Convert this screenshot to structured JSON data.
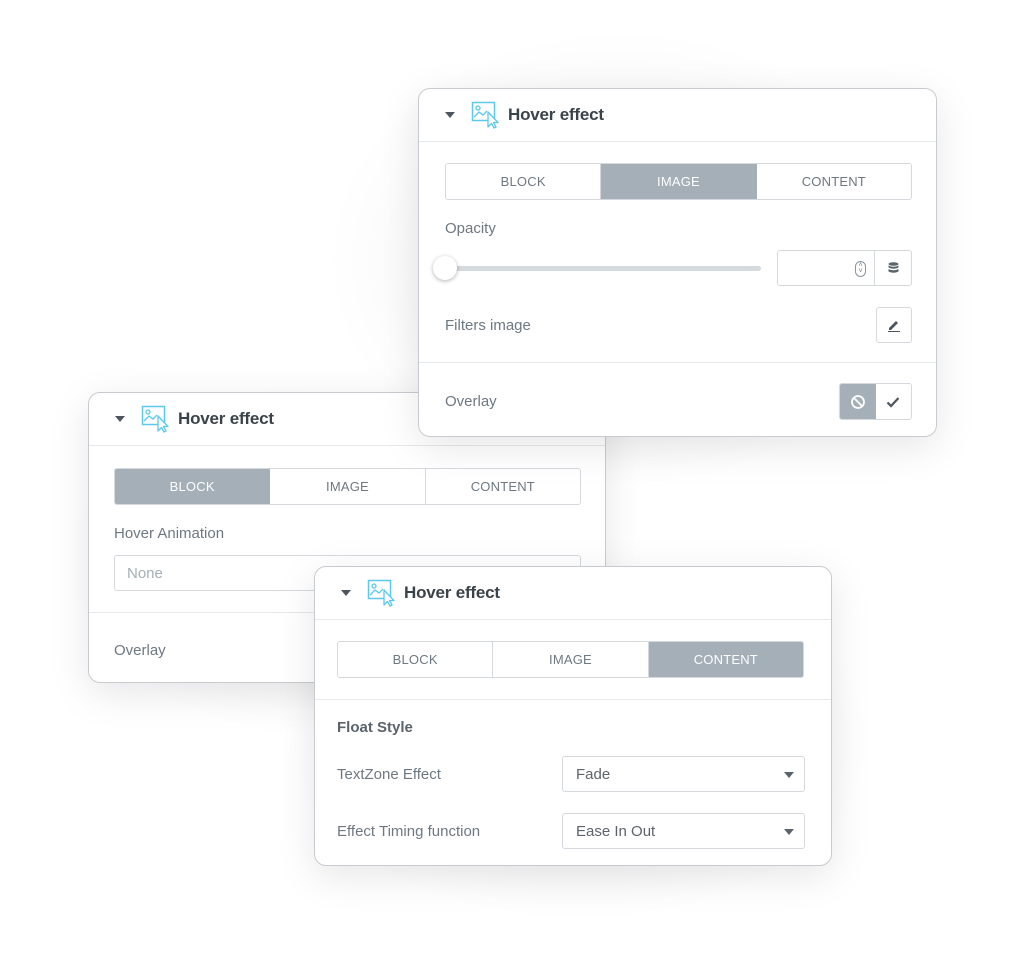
{
  "panels": {
    "top": {
      "title": "Hover effect",
      "icon": "image-hover-icon",
      "tabs": [
        {
          "label": "BLOCK",
          "active": false
        },
        {
          "label": "IMAGE",
          "active": true
        },
        {
          "label": "CONTENT",
          "active": false
        }
      ],
      "opacity_label": "Opacity",
      "opacity_value": "",
      "opacity_slider_fraction": 0,
      "filters_label": "Filters image",
      "overlay_label": "Overlay",
      "overlay_state": "off"
    },
    "left": {
      "title": "Hover effect",
      "icon": "image-hover-icon",
      "tabs": [
        {
          "label": "BLOCK",
          "active": true
        },
        {
          "label": "IMAGE",
          "active": false
        },
        {
          "label": "CONTENT",
          "active": false
        }
      ],
      "hover_animation_label": "Hover Animation",
      "hover_animation_placeholder": "None",
      "overlay_label": "Overlay"
    },
    "bottom": {
      "title": "Hover effect",
      "icon": "image-hover-icon",
      "tabs": [
        {
          "label": "BLOCK",
          "active": false
        },
        {
          "label": "IMAGE",
          "active": false
        },
        {
          "label": "CONTENT",
          "active": true
        }
      ],
      "section_title": "Float Style",
      "textzone_label": "TextZone Effect",
      "textzone_value": "Fade",
      "timing_label": "Effect Timing function",
      "timing_value": "Ease In Out"
    }
  },
  "colors": {
    "active_tab": "#a4afb7",
    "icon_accent": "#5bc8ec",
    "title_text": "#3b434a",
    "label_text": "#6d7882"
  }
}
